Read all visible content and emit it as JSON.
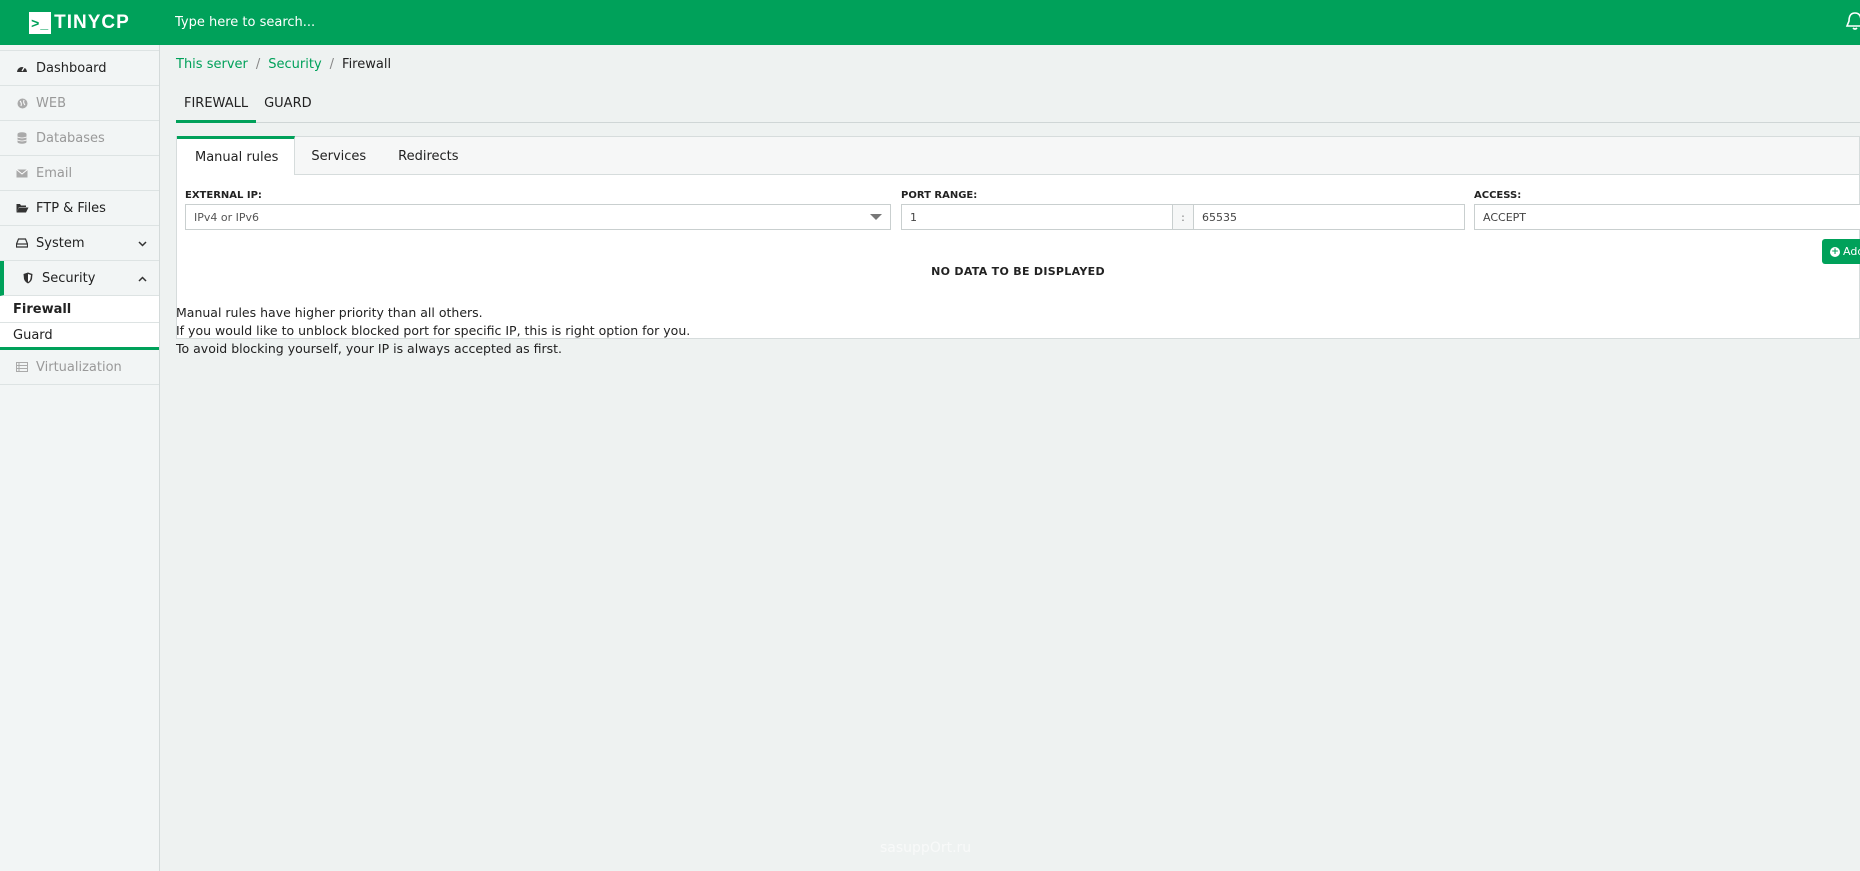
{
  "app": {
    "logo_text": "TINYCP"
  },
  "search": {
    "placeholder": "Type here to search..."
  },
  "sidebar": {
    "items": [
      {
        "label": "Dashboard",
        "icon": "dashboard-icon"
      },
      {
        "label": "WEB",
        "icon": "globe-icon"
      },
      {
        "label": "Databases",
        "icon": "database-icon"
      },
      {
        "label": "Email",
        "icon": "envelope-icon"
      },
      {
        "label": "FTP & Files",
        "icon": "folder-open-icon"
      },
      {
        "label": "System",
        "icon": "hdd-icon"
      },
      {
        "label": "Security",
        "icon": "shield-icon"
      },
      {
        "label": "Virtualization",
        "icon": "server-icon"
      }
    ],
    "security_sub": [
      {
        "label": "Firewall"
      },
      {
        "label": "Guard"
      }
    ]
  },
  "breadcrumb": {
    "items": [
      "This server",
      "Security",
      "Firewall"
    ]
  },
  "tabs": {
    "top": [
      "FIREWALL",
      "GUARD"
    ],
    "sub": [
      "Manual rules",
      "Services",
      "Redirects"
    ]
  },
  "form": {
    "external_ip_label": "EXTERNAL IP:",
    "external_ip_value": "IPv4 or IPv6",
    "port_range_label": "PORT RANGE:",
    "port_from": "1",
    "port_separator": ":",
    "port_to": "65535",
    "access_label": "ACCESS:",
    "access_value": "ACCEPT",
    "add_button": "Add"
  },
  "table": {
    "empty_text": "NO DATA TO BE DISPLAYED"
  },
  "notes": [
    "Manual rules have higher priority than all others.",
    "If you would like to unblock blocked port for specific IP, this is right option for you.",
    "To avoid blocking yourself, your IP is always accepted as first."
  ],
  "watermark": "sasuppOrt.ru",
  "colors": {
    "brand": "#00a15a",
    "background": "#eef2f1"
  }
}
